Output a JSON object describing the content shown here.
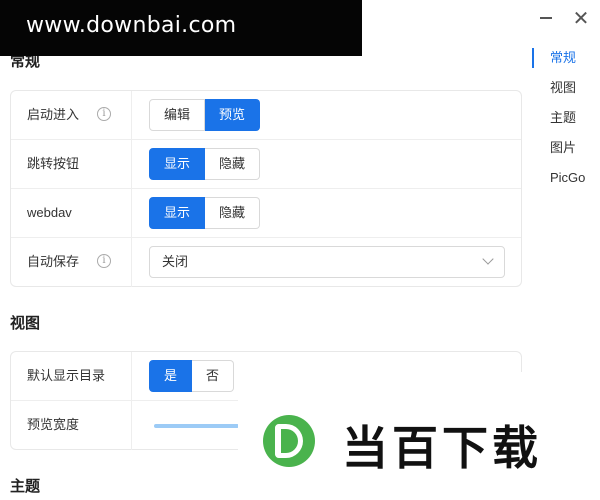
{
  "watermark_top": "www.downbai.com",
  "window": {
    "close_glyph": "✕"
  },
  "nav": {
    "items": [
      {
        "label": "常规",
        "active": true
      },
      {
        "label": "视图"
      },
      {
        "label": "主题"
      },
      {
        "label": "图片"
      },
      {
        "label": "PicGo"
      }
    ]
  },
  "sections": {
    "general": {
      "title": "常规",
      "startup": {
        "label": "启动进入",
        "options": [
          "编辑",
          "预览"
        ],
        "selected": "预览"
      },
      "jump_button": {
        "label": "跳转按钮",
        "options": [
          "显示",
          "隐藏"
        ],
        "selected": "显示"
      },
      "webdav": {
        "label": "webdav",
        "options": [
          "显示",
          "隐藏"
        ],
        "selected": "显示"
      },
      "autosave": {
        "label": "自动保存",
        "value": "关闭"
      }
    },
    "view": {
      "title": "视图",
      "default_toc": {
        "label": "默认显示目录",
        "options": [
          "是",
          "否"
        ],
        "selected": "是"
      },
      "preview_width": {
        "label": "预览宽度"
      }
    },
    "theme": {
      "title": "主题"
    }
  },
  "watermark_bottom": "当百下载",
  "icons": {
    "info": "info-icon",
    "chevron": "chevron-down-icon",
    "close": "close-icon",
    "minimize": "minimize-icon"
  },
  "colors": {
    "accent": "#1a73e8",
    "slider": "#9ccbf6",
    "logo_green": "#4ab34d"
  }
}
